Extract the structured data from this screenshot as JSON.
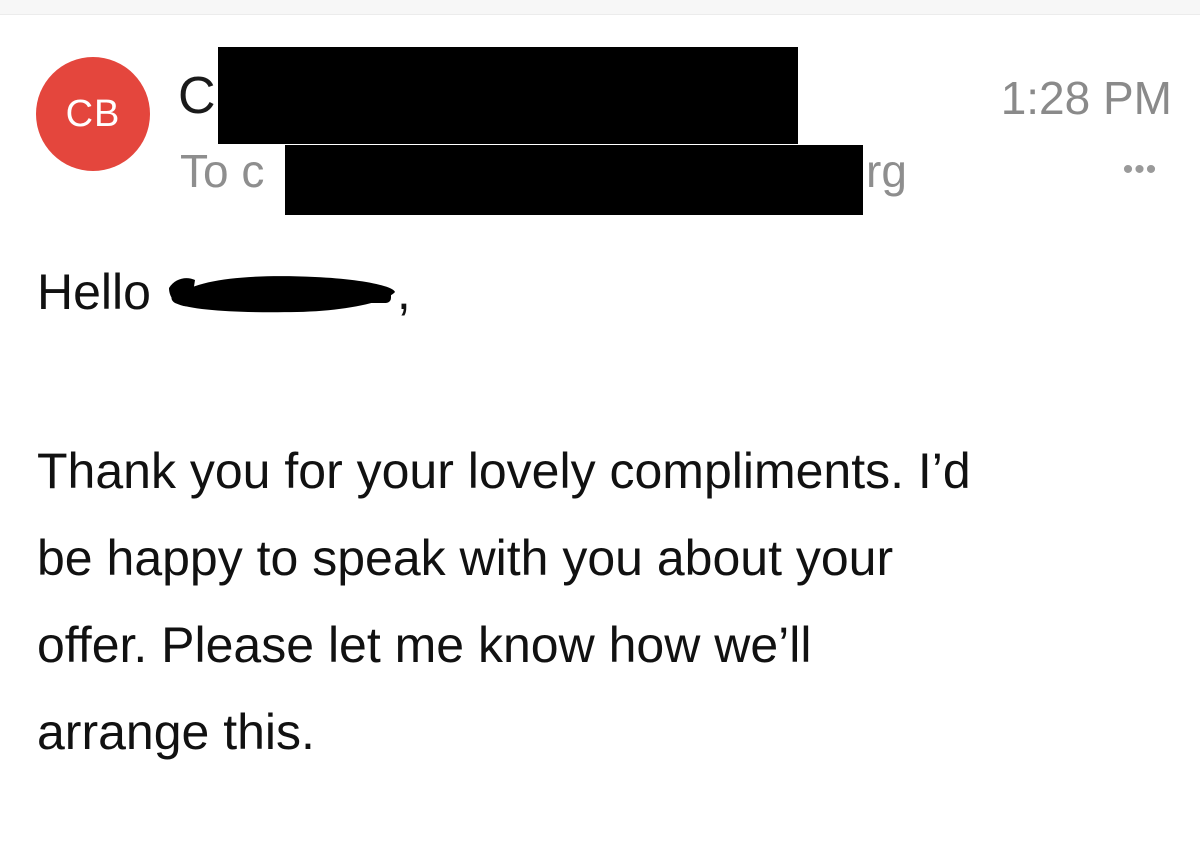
{
  "colors": {
    "avatar_bg": "#e4463d",
    "redaction": "#000000"
  },
  "header": {
    "avatar_initials": "CB",
    "sender_visible": "C",
    "recipient_prefix": "To c",
    "recipient_suffix": "rg",
    "time": "1:28 PM",
    "more_icon": "more-horizontal-icon"
  },
  "email": {
    "greeting_word": "Hello",
    "greeting_punct": ",",
    "body_lines": [
      "Thank you for your lovely compliments. I’d",
      "be happy to speak with you about your",
      "offer. Please let me know how we’ll",
      "arrange this."
    ]
  }
}
